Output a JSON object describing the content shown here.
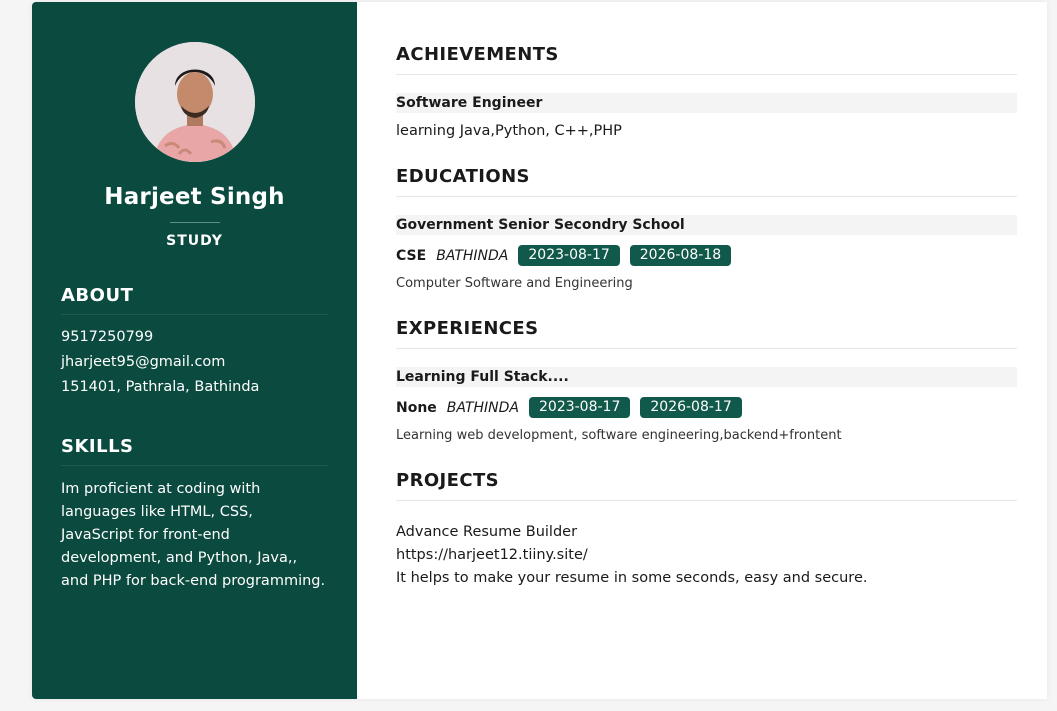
{
  "profile": {
    "name": "Harjeet Singh",
    "role": "STUDY"
  },
  "about": {
    "heading": "ABOUT",
    "phone": "9517250799",
    "email": "jharjeet95@gmail.com",
    "address": "151401, Pathrala, Bathinda"
  },
  "skills": {
    "heading": "SKILLS",
    "text": "Im proficient at coding with languages like HTML, CSS, JavaScript for front-end development, and Python, Java,, and PHP for back-end programming."
  },
  "achievements": {
    "heading": "ACHIEVEMENTS",
    "title": "Software Engineer",
    "text": "learning Java,Python, C++,PHP"
  },
  "educations": {
    "heading": "EDUCATIONS",
    "title": "Government Senior Secondry School",
    "degree": "CSE",
    "location": "BATHINDA",
    "start": "2023-08-17",
    "end": "2026-08-18",
    "description": "Computer Software and Engineering"
  },
  "experiences": {
    "heading": "EXPERIENCES",
    "title": "Learning Full Stack....",
    "position": "None",
    "location": "BATHINDA",
    "start": "2023-08-17",
    "end": "2026-08-17",
    "description": "Learning web development, software engineering,backend+frontent"
  },
  "projects": {
    "heading": "PROJECTS",
    "name": "Advance Resume Builder",
    "link": "https://harjeet12.tiiny.site/",
    "description": "It helps to make your resume in some seconds, easy and secure."
  },
  "colors": {
    "sidebar": "#0a4a3f",
    "badge": "#10594b"
  }
}
